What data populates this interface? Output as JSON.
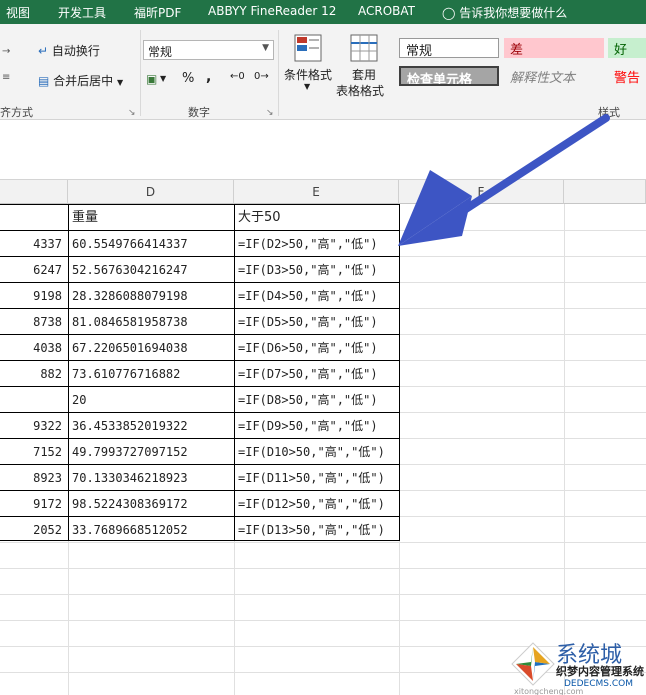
{
  "menu": {
    "items": [
      "视图",
      "开发工具",
      "福昕PDF",
      "ABBYY FineReader 12",
      "ACROBAT"
    ],
    "tell_me": "告诉我你想要做什么"
  },
  "ribbon": {
    "wrap_text": "自动换行",
    "merge_center": "合并后居中",
    "alignment_group": "齐方式",
    "number_format": "常规",
    "number_group": "数字",
    "conditional_format": "条件格式",
    "format_as_table_1": "套用",
    "format_as_table_2": "表格格式",
    "styles_group": "样式",
    "style_normal": "常规",
    "style_bad": "差",
    "style_good": "好",
    "style_check_cell": "检查单元格",
    "style_explanatory": "解释性文本",
    "style_warning": "警告",
    "pct_symbol": "%",
    "comma_symbol": ","
  },
  "sheet": {
    "columns": [
      "D",
      "E",
      "F"
    ],
    "header_row": {
      "d": "重量",
      "e": "大于50"
    },
    "rows": [
      {
        "c": "4337",
        "d": "60.5549766414337",
        "e": "=IF(D2>50,\"高\",\"低\")"
      },
      {
        "c": "6247",
        "d": "52.5676304216247",
        "e": "=IF(D3>50,\"高\",\"低\")"
      },
      {
        "c": "9198",
        "d": "28.3286088079198",
        "e": "=IF(D4>50,\"高\",\"低\")"
      },
      {
        "c": "8738",
        "d": "81.0846581958738",
        "e": "=IF(D5>50,\"高\",\"低\")"
      },
      {
        "c": "4038",
        "d": "67.2206501694038",
        "e": "=IF(D6>50,\"高\",\"低\")"
      },
      {
        "c": "882",
        "d": "73.610776716882",
        "e": "=IF(D7>50,\"高\",\"低\")"
      },
      {
        "c": "",
        "d": "20",
        "e": "=IF(D8>50,\"高\",\"低\")"
      },
      {
        "c": "9322",
        "d": "36.4533852019322",
        "e": "=IF(D9>50,\"高\",\"低\")"
      },
      {
        "c": "7152",
        "d": "49.7993727097152",
        "e": "=IF(D10>50,\"高\",\"低\")"
      },
      {
        "c": "8923",
        "d": "70.1330346218923",
        "e": "=IF(D11>50,\"高\",\"低\")"
      },
      {
        "c": "9172",
        "d": "98.5224308369172",
        "e": "=IF(D12>50,\"高\",\"低\")"
      },
      {
        "c": "2052",
        "d": "33.7689668512052",
        "e": "=IF(D13>50,\"高\",\"低\")"
      }
    ]
  },
  "watermark": {
    "brand": "系统城",
    "line1": "织梦内容管理系统",
    "line2": "DEDECMS.COM",
    "line3": "xitongcheng.com"
  },
  "colors": {
    "menubar": "#217346",
    "arrow": "#3d55c4",
    "bad_fill": "#ffc7ce",
    "good_fill": "#c6efce"
  }
}
